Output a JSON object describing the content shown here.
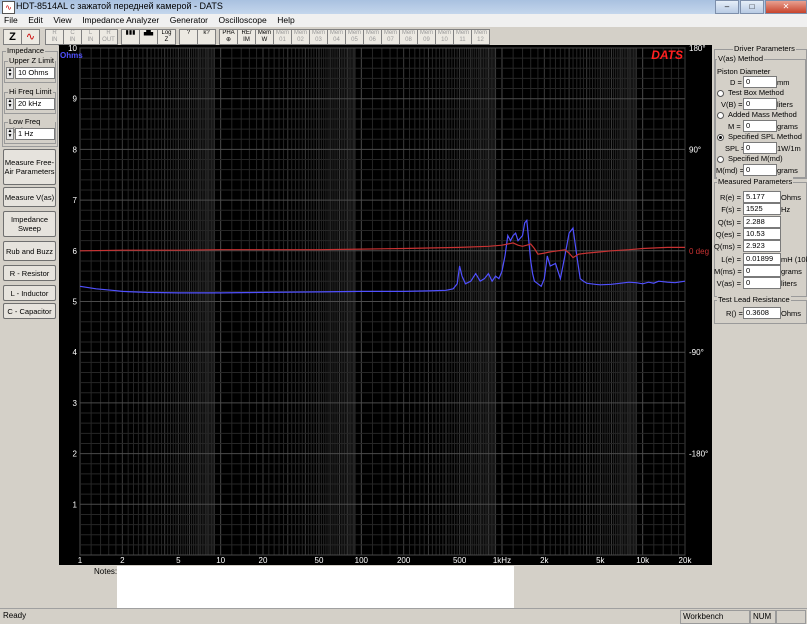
{
  "window": {
    "title": "HDT-8514AL с зажатой передней камерой - DATS",
    "buttons": [
      "–",
      "□",
      "✕"
    ]
  },
  "menu": [
    "File",
    "Edit",
    "View",
    "Impedance Analyzer",
    "Generator",
    "Oscilloscope",
    "Help"
  ],
  "toolbar": {
    "buttons": [
      {
        "label": "Z",
        "icon": "impedance-icon",
        "enabled": true
      },
      {
        "label": "∿",
        "icon": "sine-icon",
        "enabled": true
      },
      {
        "label": "R\nIN",
        "icon": "resistor-icon",
        "enabled": false
      },
      {
        "label": "C\nIN",
        "icon": "capacitor-icon",
        "enabled": false
      },
      {
        "label": "L\nIN",
        "icon": "inductor-icon",
        "enabled": false
      },
      {
        "label": "R\nOUT",
        "icon": "resistor-out-icon",
        "enabled": false
      },
      {
        "label": "▮▮▮",
        "icon": "bars-icon",
        "enabled": true
      },
      {
        "label": "▟▙",
        "icon": "peak-icon",
        "enabled": true
      },
      {
        "label": "Log\nZ",
        "icon": "log-z-icon",
        "enabled": true
      },
      {
        "label": "?",
        "icon": "help-icon",
        "enabled": true
      },
      {
        "label": "k?",
        "icon": "context-help-icon",
        "enabled": true
      },
      {
        "label": "PHA\n⊕",
        "icon": "phase-icon",
        "enabled": true
      },
      {
        "label": "RE/\nIM",
        "icon": "re-im-icon",
        "enabled": true
      },
      {
        "label": "Mem\nW",
        "icon": "memory-write-icon",
        "enabled": true
      },
      {
        "label": "Mem\n01",
        "icon": "memory-1-icon",
        "enabled": false
      },
      {
        "label": "Mem\n02",
        "icon": "memory-2-icon",
        "enabled": false
      },
      {
        "label": "Mem\n03",
        "icon": "memory-3-icon",
        "enabled": false
      },
      {
        "label": "Mem\n04",
        "icon": "memory-4-icon",
        "enabled": false
      },
      {
        "label": "Mem\n05",
        "icon": "memory-5-icon",
        "enabled": false
      },
      {
        "label": "Mem\n06",
        "icon": "memory-6-icon",
        "enabled": false
      },
      {
        "label": "Mem\n07",
        "icon": "memory-7-icon",
        "enabled": false
      },
      {
        "label": "Mem\n08",
        "icon": "memory-8-icon",
        "enabled": false
      },
      {
        "label": "Mem\n09",
        "icon": "memory-9-icon",
        "enabled": false
      },
      {
        "label": "Mem\n10",
        "icon": "memory-10-icon",
        "enabled": false
      },
      {
        "label": "Mem\n11",
        "icon": "memory-11-icon",
        "enabled": false
      },
      {
        "label": "Mem\n12",
        "icon": "memory-12-icon",
        "enabled": false
      }
    ]
  },
  "left": {
    "impedance_title": "Impedance",
    "upper_z": {
      "label": "Upper Z Limit",
      "value": "10 Ohms"
    },
    "hi_freq": {
      "label": "Hi Freq Limit",
      "value": "20 kHz"
    },
    "low_freq": {
      "label": "Low Freq Limit",
      "value": "1 Hz"
    },
    "buttons": [
      "Measure Free-Air Parameters",
      "Measure V(as)",
      "Impedance Sweep",
      "Rub and Buzz",
      "R - Resistor",
      "L - Inductor",
      "C - Capacitor"
    ]
  },
  "right": {
    "driver_title": "Driver Parameters",
    "vas_method": "V(as) Method",
    "piston_diameter": "Piston Diameter",
    "d_label": "D =",
    "d_value": "0",
    "d_unit": "mm",
    "test_box": "Test Box Method",
    "vb_label": "V(B) =",
    "vb_value": "0",
    "vb_unit": "liters",
    "added_mass": "Added Mass Method",
    "m_label": "M =",
    "m_value": "0",
    "m_unit": "grams",
    "specified_spl": "Specified SPL Method",
    "spl_label": "SPL =",
    "spl_value": "0",
    "spl_unit": "1W/1m",
    "specified_mmd": "Specified M(md)",
    "mmd_label": "M(md) =",
    "mmd_value": "0",
    "mmd_unit": "grams",
    "measured_title": "Measured Parameters",
    "measured": [
      {
        "label": "R(e) =",
        "value": "5.177",
        "unit": "Ohms"
      },
      {
        "label": "F(s) =",
        "value": "1525",
        "unit": "Hz"
      },
      {
        "label": "Q(ts) =",
        "value": "2.288",
        "unit": ""
      },
      {
        "label": "Q(es) =",
        "value": "10.53",
        "unit": ""
      },
      {
        "label": "Q(ms) =",
        "value": "2.923",
        "unit": ""
      },
      {
        "label": "L(e) =",
        "value": "0.01899",
        "unit": "mH (10k)"
      },
      {
        "label": "M(ms) =",
        "value": "0",
        "unit": "grams"
      },
      {
        "label": "V(as) =",
        "value": "0",
        "unit": "liters"
      }
    ],
    "lead_title": "Test Lead Resistance",
    "lead_label": "R() =",
    "lead_value": "0.3608",
    "lead_unit": "Ohms"
  },
  "notes": {
    "label": "Notes:",
    "value": ""
  },
  "status": {
    "ready": "Ready",
    "mode": "Workbench",
    "num": "NUM"
  },
  "colors": {
    "impedance": "#5050ff",
    "phase": "#c83232",
    "brand": "#ff2020",
    "grid": "#3c3c3c",
    "ohms_label": "#5050ff",
    "axis_text": "#ffffff"
  },
  "chart_data": {
    "type": "line",
    "title": "",
    "brand": "DATS",
    "xscale": "log",
    "xlim": [
      1,
      20000
    ],
    "ylim": [
      0,
      10
    ],
    "y2lim": [
      -270,
      180
    ],
    "ylabel": "Ohms",
    "y2unit_label": "0 deg",
    "xticks": [
      1,
      2,
      5,
      10,
      20,
      50,
      100,
      200,
      500,
      1000,
      2000,
      5000,
      10000,
      20000
    ],
    "xtick_labels": [
      "1",
      "2",
      "5",
      "10",
      "20",
      "50",
      "100",
      "200",
      "500",
      "1kHz",
      "2k",
      "5k",
      "10k",
      "20k"
    ],
    "yticks": [
      1,
      2,
      3,
      4,
      5,
      6,
      7,
      8,
      9,
      10
    ],
    "ytick_labels": [
      "1",
      "2",
      "3",
      "4",
      "5",
      "6",
      "7",
      "8",
      "9",
      "10"
    ],
    "y2ticks": [
      180,
      90,
      -90,
      -180
    ],
    "y2tick_labels": [
      "180°",
      "90°",
      "-90°",
      "-180°"
    ],
    "grid": true,
    "series": [
      {
        "name": "impedance",
        "axis": "left",
        "x": [
          1,
          1.3,
          1.7,
          2,
          3,
          5,
          10,
          20,
          50,
          100,
          200,
          300,
          400,
          450,
          480,
          500,
          520,
          550,
          600,
          650,
          700,
          750,
          800,
          850,
          900,
          950,
          1000,
          1050,
          1100,
          1150,
          1200,
          1250,
          1300,
          1350,
          1400,
          1450,
          1500,
          1550,
          1600,
          1650,
          1700,
          1800,
          1900,
          2000,
          2100,
          2200,
          2400,
          2600,
          2800,
          3000,
          3200,
          3400,
          3600,
          3800,
          4000,
          4300,
          4600,
          5000,
          6000,
          7000,
          8000,
          9000,
          10000,
          11000,
          12000,
          13000,
          15000,
          17000,
          20000
        ],
        "y": [
          5.3,
          5.25,
          5.22,
          5.2,
          5.18,
          5.17,
          5.17,
          5.18,
          5.19,
          5.2,
          5.2,
          5.21,
          5.22,
          5.25,
          5.35,
          5.7,
          5.5,
          5.35,
          5.4,
          5.55,
          5.4,
          5.45,
          5.55,
          5.4,
          5.5,
          5.45,
          5.6,
          5.9,
          6.3,
          6.2,
          6.3,
          6.35,
          6.2,
          6.25,
          6.3,
          6.55,
          6.6,
          6.2,
          5.8,
          5.55,
          5.4,
          5.35,
          5.3,
          5.45,
          5.9,
          5.7,
          5.75,
          5.45,
          5.9,
          6.35,
          6.45,
          5.9,
          5.45,
          5.4,
          5.36,
          5.35,
          5.34,
          5.33,
          5.34,
          5.36,
          5.38,
          5.37,
          5.35,
          5.38,
          5.36,
          5.4,
          5.38,
          5.37,
          5.4
        ]
      },
      {
        "name": "phase",
        "axis": "right",
        "x": [
          1,
          2,
          5,
          10,
          20,
          50,
          100,
          200,
          500,
          800,
          1000,
          1100,
          1200,
          1300,
          1400,
          1500,
          1600,
          1700,
          1800,
          2000,
          2200,
          2500,
          2800,
          3000,
          3200,
          3500,
          4000,
          5000,
          6000,
          8000,
          10000,
          15000,
          20000
        ],
        "y": [
          0,
          0.5,
          0.5,
          1,
          1,
          1,
          1.5,
          2,
          3,
          4,
          5,
          6,
          7,
          5,
          4,
          5,
          6,
          2,
          -3,
          -2,
          -1,
          0,
          1,
          -2,
          -6,
          -3,
          -2,
          -1,
          0,
          1,
          2,
          3,
          3
        ]
      }
    ]
  }
}
